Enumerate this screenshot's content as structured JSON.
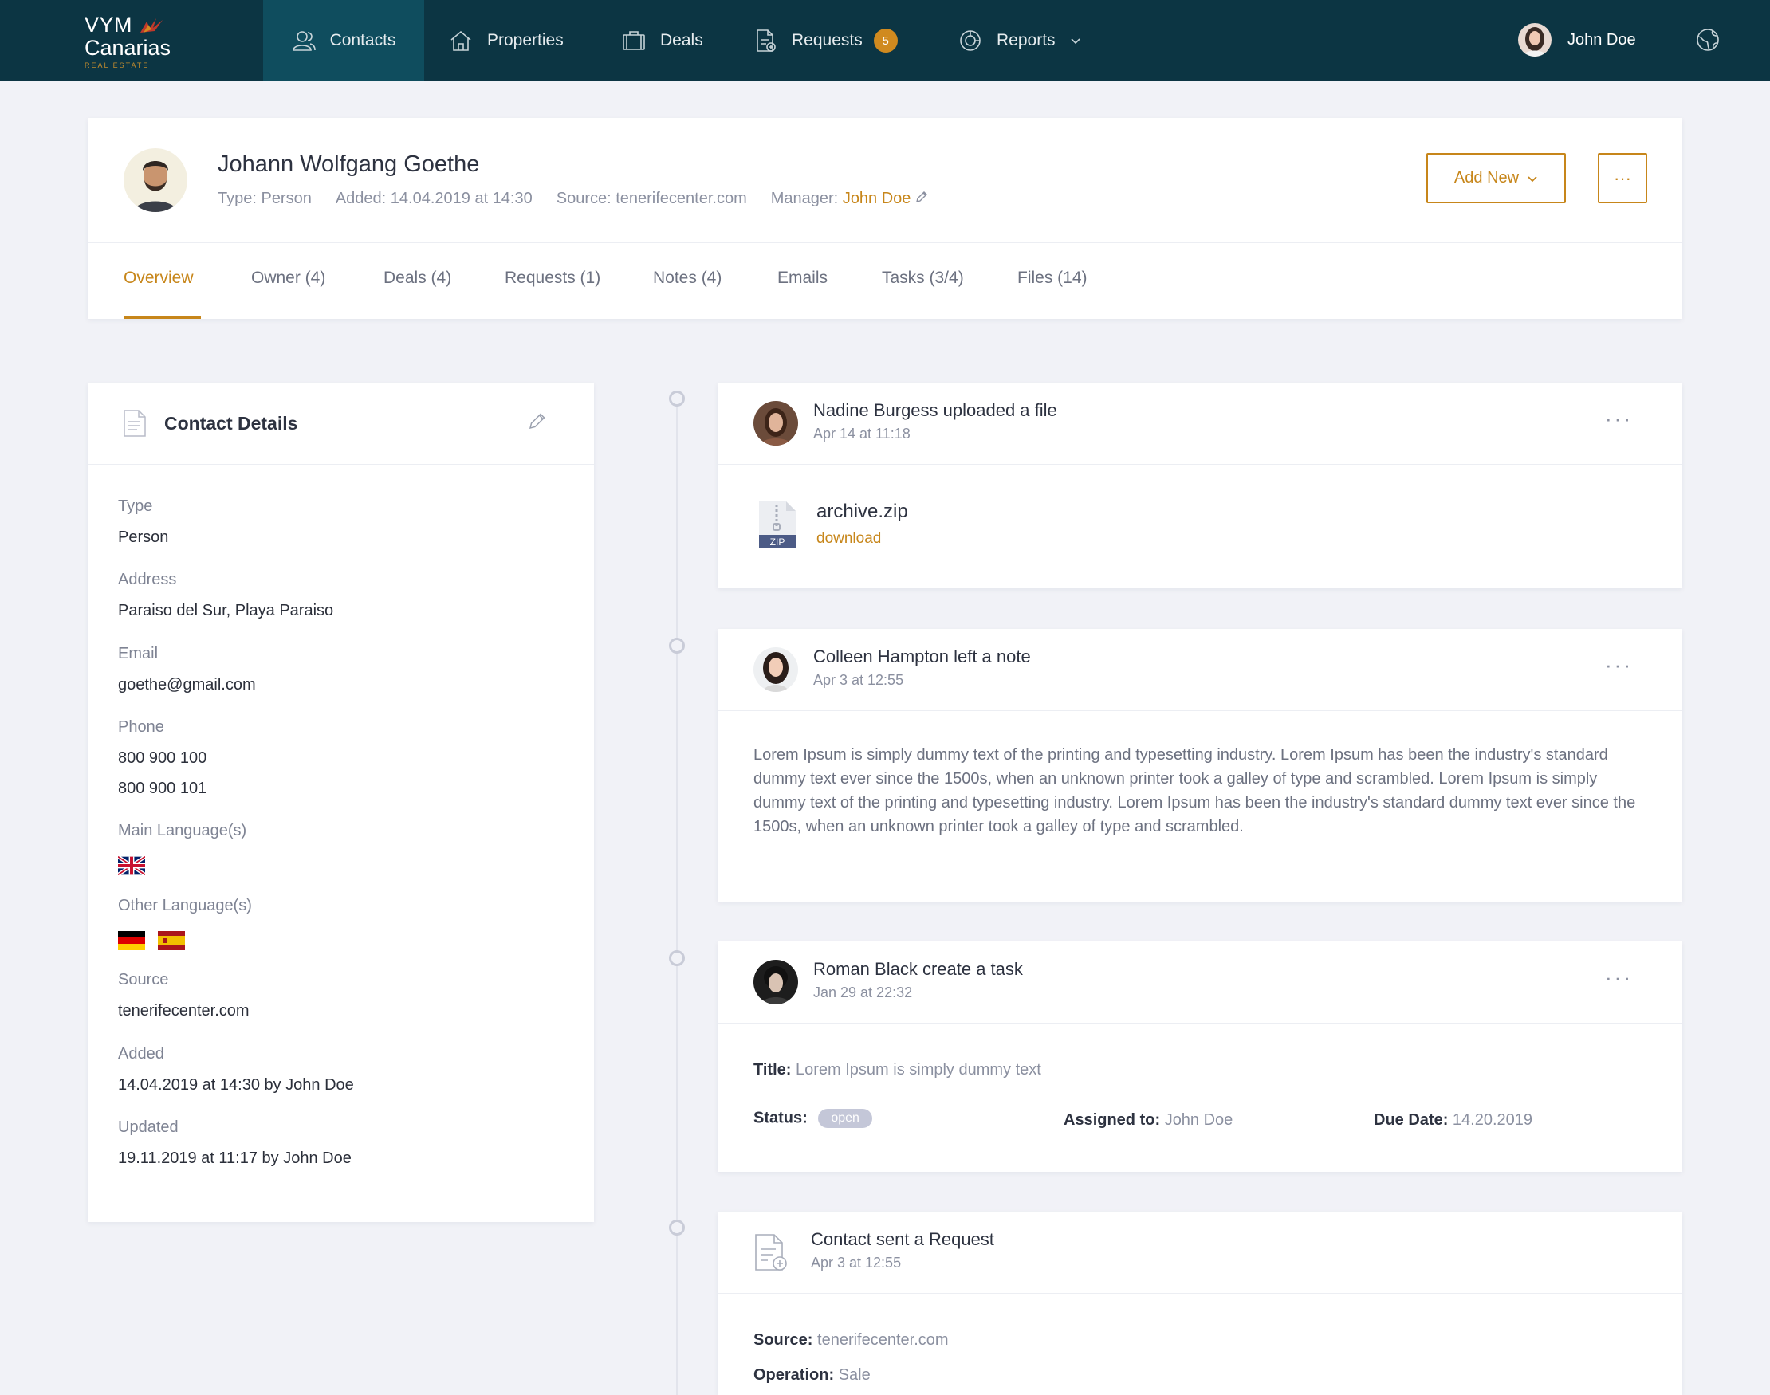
{
  "nav": {
    "logo_line1": "VYM",
    "logo_line2": "Canarias",
    "logo_line3": "REAL ESTATE",
    "items": [
      {
        "label": "Contacts"
      },
      {
        "label": "Properties"
      },
      {
        "label": "Deals"
      },
      {
        "label": "Requests",
        "badge": "5"
      },
      {
        "label": "Reports"
      }
    ],
    "user_name": "John Doe"
  },
  "contact": {
    "name": "Johann Wolfgang Goethe",
    "type": "Type: Person",
    "added": "Added: 14.04.2019 at 14:30",
    "source": "Source: tenerifecenter.com",
    "manager_label": "Manager:",
    "manager_name": "John Doe",
    "add_new_label": "Add New",
    "more_label": "···"
  },
  "tabs": [
    "Overview",
    "Owner (4)",
    "Deals (4)",
    "Requests (1)",
    "Notes (4)",
    "Emails",
    "Tasks (3/4)",
    "Files (14)"
  ],
  "details": {
    "title": "Contact Details",
    "fields": {
      "type_label": "Type",
      "type_value": "Person",
      "address_label": "Address",
      "address_value": "Paraiso del Sur, Playa Paraiso",
      "email_label": "Email",
      "email_value": "goethe@gmail.com",
      "phone_label": "Phone",
      "phone_value1": "800 900 100",
      "phone_value2": "800 900 101",
      "main_lang_label": "Main Language(s)",
      "other_lang_label": "Other Language(s)",
      "source_label": "Source",
      "source_value": "tenerifecenter.com",
      "added_label": "Added",
      "added_value": "14.04.2019 at 14:30 by John Doe",
      "updated_label": "Updated",
      "updated_value": "19.11.2019 at 11:17 by John Doe"
    }
  },
  "activities": {
    "file": {
      "title": "Nadine Burgess uploaded a file",
      "time": "Apr 14 at 11:18",
      "file_name": "archive.zip",
      "file_type": "ZIP",
      "link": "download"
    },
    "note": {
      "title": "Colleen Hampton left a note",
      "time": "Apr 3 at 12:55",
      "text": "Lorem Ipsum is simply dummy text of the printing and typesetting industry. Lorem Ipsum has been the industry's standard dummy text ever since the 1500s, when an unknown printer took a galley of type and scrambled. Lorem Ipsum is simply dummy text of the printing and typesetting industry. Lorem Ipsum has been the industry's standard dummy text ever since the 1500s, when an unknown printer took a galley of type and scrambled."
    },
    "task": {
      "title": "Roman Black create a task",
      "time": "Jan 29 at 22:32",
      "title_label": "Title:",
      "title_value": "Lorem Ipsum is simply dummy text",
      "status_label": "Status:",
      "status_value": "open",
      "assigned_label": "Assigned to:",
      "assigned_value": "John Doe",
      "due_label": "Due Date:",
      "due_value": "14.20.2019"
    },
    "request": {
      "title": "Contact sent a Request",
      "time": "Apr 3 at 12:55",
      "source_label": "Source:",
      "source_value": "tenerifecenter.com",
      "operation_label": "Operation:",
      "operation_value": "Sale"
    },
    "menu_dots": "···"
  },
  "colors": {
    "nav_bg": "#0c3543",
    "nav_active": "#0f4d5e",
    "accent": "#c7861a",
    "page_bg": "#f1f2f7"
  }
}
